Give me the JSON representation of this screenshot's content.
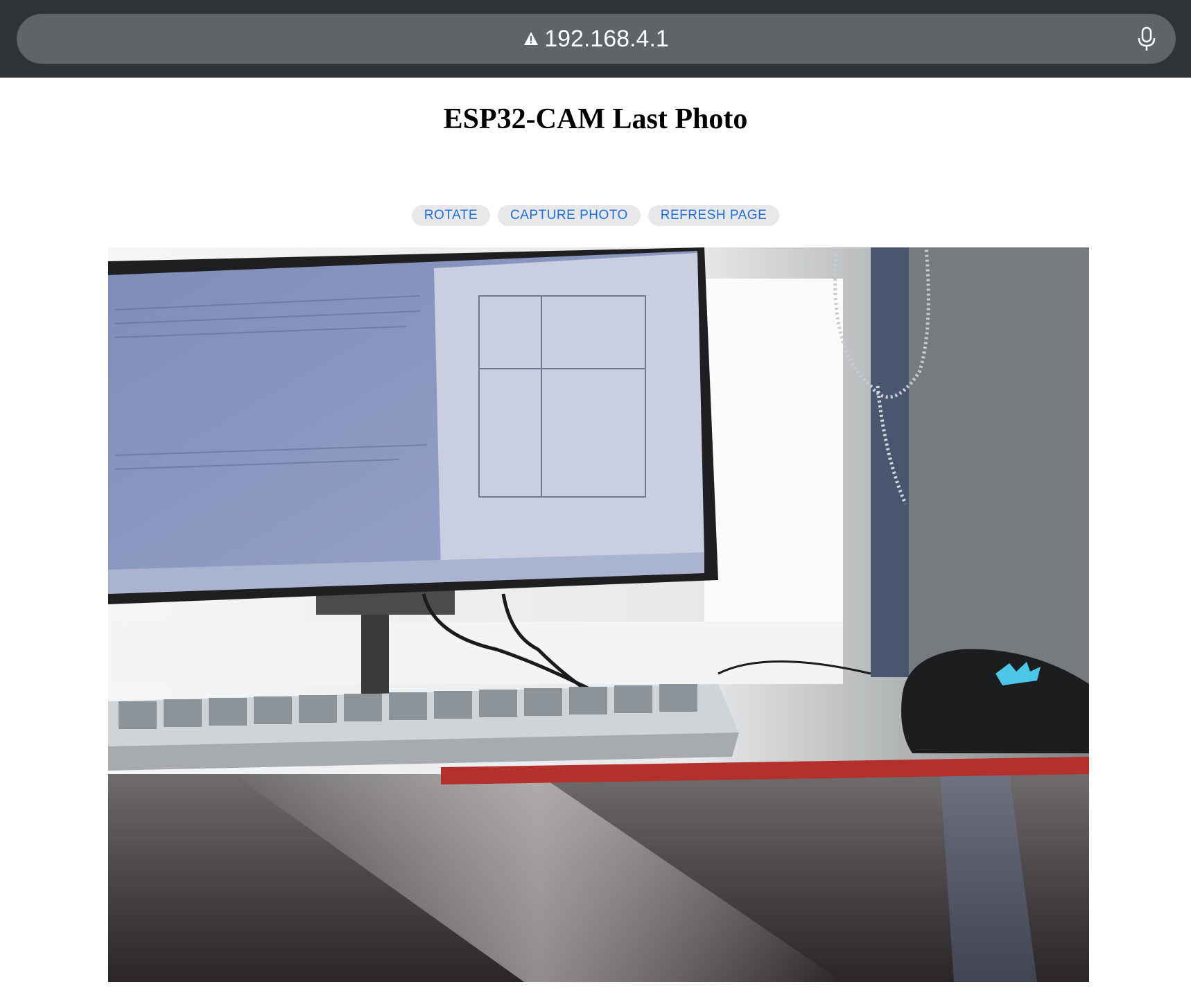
{
  "browser": {
    "url": "192.168.4.1",
    "security_icon": "warning-triangle-icon",
    "voice_icon": "microphone-icon"
  },
  "page": {
    "title": "ESP32-CAM Last Photo",
    "buttons": [
      {
        "label": "ROTATE"
      },
      {
        "label": "CAPTURE PHOTO"
      },
      {
        "label": "REFRESH PAGE"
      }
    ],
    "photo_description": "camera photo of a desk with monitor, keyboard and mouse"
  },
  "colors": {
    "browser_bar": "#2e3336",
    "url_field": "#5f6468",
    "button_bg": "#e8e8ea",
    "button_text": "#1f6fd6"
  }
}
